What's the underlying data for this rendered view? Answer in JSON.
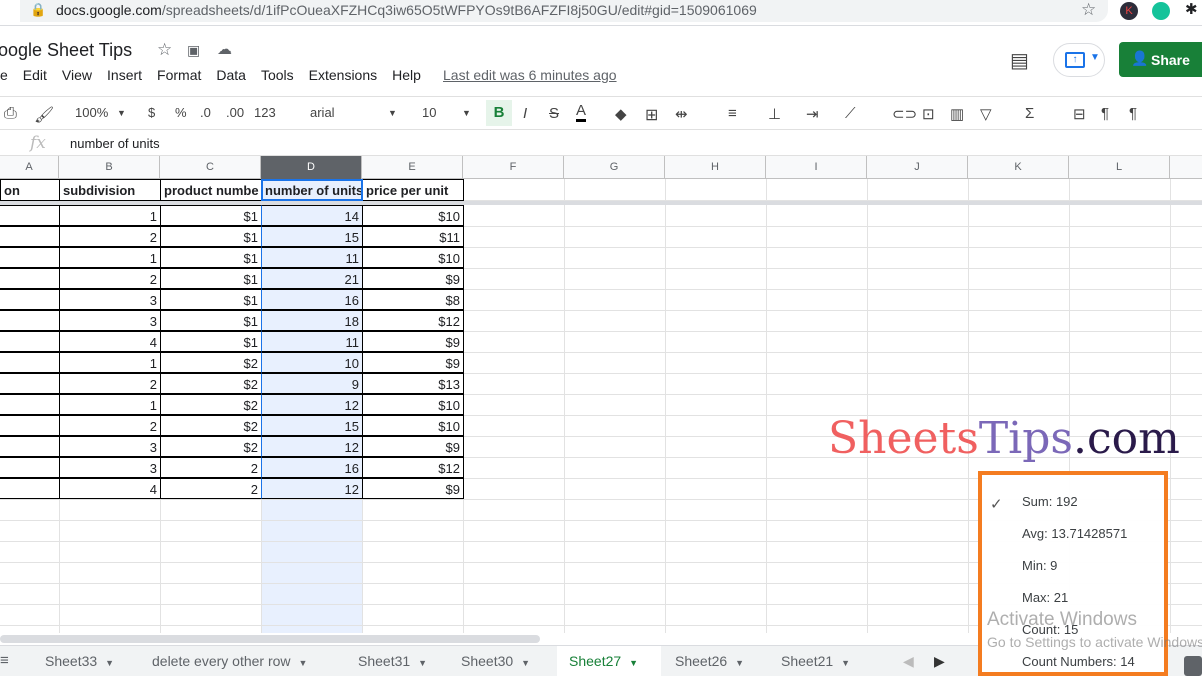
{
  "browser": {
    "url_host": "docs.google.com",
    "url_path": "/spreadsheets/d/1ifPcOueaXFZHCq3iw65O5tWFPYOs9tB6AFZFI8j50GU/edit#gid=1509061069"
  },
  "doc": {
    "title": "oogle Sheet Tips",
    "last_edit": "Last edit was 6 minutes ago",
    "share_label": "Share"
  },
  "menu": [
    "e",
    "Edit",
    "View",
    "Insert",
    "Format",
    "Data",
    "Tools",
    "Extensions",
    "Help"
  ],
  "toolbar": {
    "zoom": "100%",
    "currency": "$",
    "percent": "%",
    "dec_less": ".0",
    "dec_more": ".00",
    "format": "123",
    "font": "arial",
    "font_size": "10",
    "bold": "B",
    "italic": "I",
    "strike": "S",
    "text_color": "A"
  },
  "formula_bar": {
    "fx": "fx",
    "value": "number of units"
  },
  "columns": [
    "A",
    "B",
    "C",
    "D",
    "E",
    "F",
    "G",
    "H",
    "I",
    "J",
    "K",
    "L"
  ],
  "selected_column": "D",
  "headers": [
    "on",
    "subdivision",
    "product numbe",
    "number of units",
    "price per unit"
  ],
  "rows": [
    [
      "1",
      "$1",
      "14",
      "$10"
    ],
    [
      "2",
      "$1",
      "15",
      "$11"
    ],
    [
      "1",
      "$1",
      "11",
      "$10"
    ],
    [
      "2",
      "$1",
      "21",
      "$9"
    ],
    [
      "3",
      "$1",
      "16",
      "$8"
    ],
    [
      "3",
      "$1",
      "18",
      "$12"
    ],
    [
      "4",
      "$1",
      "11",
      "$9"
    ],
    [
      "1",
      "$2",
      "10",
      "$9"
    ],
    [
      "2",
      "$2",
      "9",
      "$13"
    ],
    [
      "1",
      "$2",
      "12",
      "$10"
    ],
    [
      "2",
      "$2",
      "15",
      "$10"
    ],
    [
      "3",
      "$2",
      "12",
      "$9"
    ],
    [
      "3",
      "2",
      "16",
      "$12"
    ],
    [
      "4",
      "2",
      "12",
      "$9"
    ]
  ],
  "sheet_tabs": [
    {
      "label": "Sheet33"
    },
    {
      "label": "delete every other row"
    },
    {
      "label": "Sheet31"
    },
    {
      "label": "Sheet30"
    },
    {
      "label": "Sheet27",
      "active": true
    },
    {
      "label": "Sheet26"
    },
    {
      "label": "Sheet21"
    }
  ],
  "stats_popup": {
    "items": [
      "Sum: 192",
      "Avg: 13.71428571",
      "Min: 9",
      "Max: 21",
      "Count: 15",
      "Count Numbers: 14"
    ],
    "checked": "Sum: 192",
    "border_color": "#f47c20"
  },
  "watermark": {
    "part1": "Sheets",
    "part2": "Tips",
    "part3": ".com",
    "colors": [
      "#f06060",
      "#7b68b8",
      "#2a1a4a"
    ]
  },
  "os_overlay": {
    "line1": "Activate Windows",
    "line2": "Go to Settings to activate Windows."
  },
  "colors": {
    "accent_green": "#188038",
    "selection_blue": "#1a73e8",
    "selection_fill": "#e8f0fe"
  }
}
